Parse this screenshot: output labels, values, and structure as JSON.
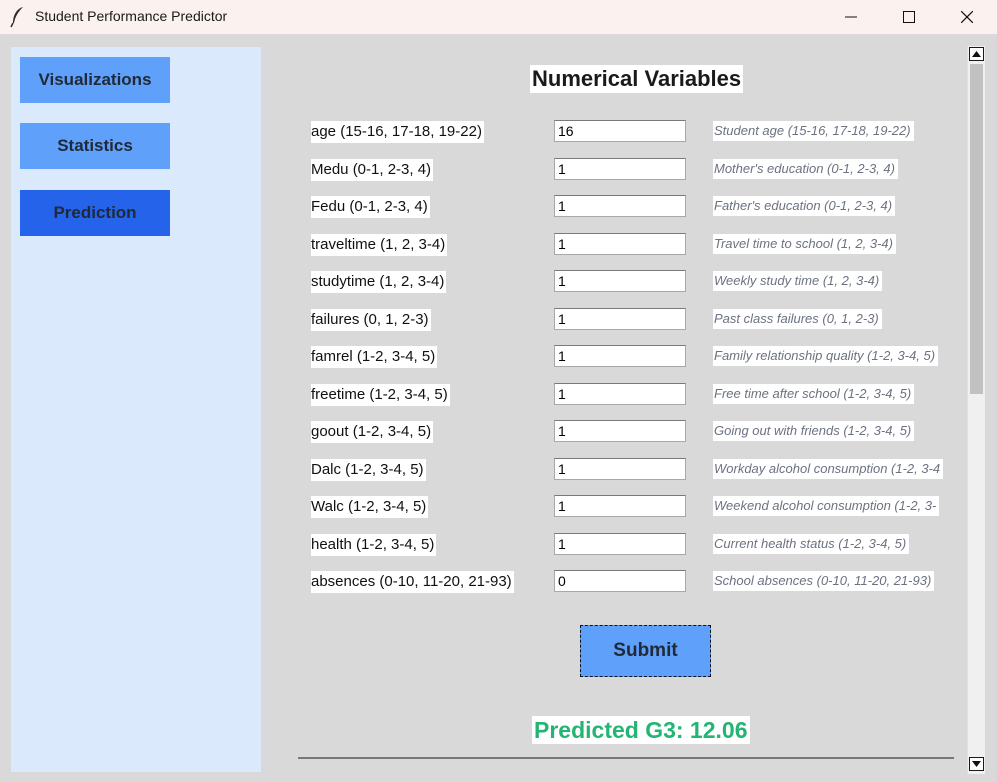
{
  "window": {
    "title": "Student Performance Predictor"
  },
  "nav": {
    "visualizations": "Visualizations",
    "statistics": "Statistics",
    "prediction": "Prediction"
  },
  "section_title": "Numerical Variables",
  "fields": [
    {
      "label": "age (15-16, 17-18, 19-22)",
      "value": "16",
      "hint": "Student age (15-16, 17-18, 19-22)"
    },
    {
      "label": "Medu (0-1, 2-3, 4)",
      "value": "1",
      "hint": "Mother's education (0-1, 2-3, 4)"
    },
    {
      "label": "Fedu (0-1, 2-3, 4)",
      "value": "1",
      "hint": "Father's education (0-1, 2-3, 4)"
    },
    {
      "label": "traveltime (1, 2, 3-4)",
      "value": "1",
      "hint": "Travel time to school (1, 2, 3-4)"
    },
    {
      "label": "studytime (1, 2, 3-4)",
      "value": "1",
      "hint": "Weekly study time (1, 2, 3-4)"
    },
    {
      "label": "failures (0, 1, 2-3)",
      "value": "1",
      "hint": "Past class failures (0, 1, 2-3)"
    },
    {
      "label": "famrel (1-2, 3-4, 5)",
      "value": "1",
      "hint": "Family relationship quality (1-2, 3-4, 5)"
    },
    {
      "label": "freetime (1-2, 3-4, 5)",
      "value": "1",
      "hint": "Free time after school (1-2, 3-4, 5)"
    },
    {
      "label": "goout (1-2, 3-4, 5)",
      "value": "1",
      "hint": "Going out with friends (1-2, 3-4, 5)"
    },
    {
      "label": "Dalc (1-2, 3-4, 5)",
      "value": "1",
      "hint": "Workday alcohol consumption (1-2, 3-4"
    },
    {
      "label": "Walc (1-2, 3-4, 5)",
      "value": "1",
      "hint": "Weekend alcohol consumption (1-2, 3-"
    },
    {
      "label": "health (1-2, 3-4, 5)",
      "value": "1",
      "hint": "Current health status (1-2, 3-4, 5)"
    },
    {
      "label": "absences (0-10, 11-20, 21-93)",
      "value": "0",
      "hint": "School absences (0-10, 11-20, 21-93)"
    }
  ],
  "submit_label": "Submit",
  "result_text": "Predicted G3: 12.06",
  "colors": {
    "nav_button": "#5fa0fb",
    "nav_active": "#2563eb",
    "sidebar_bg": "#dbe9fd",
    "result": "#22b573"
  },
  "icons": [
    "feather-icon",
    "minimize-icon",
    "maximize-icon",
    "close-icon",
    "scroll-up-icon",
    "scroll-down-icon"
  ]
}
